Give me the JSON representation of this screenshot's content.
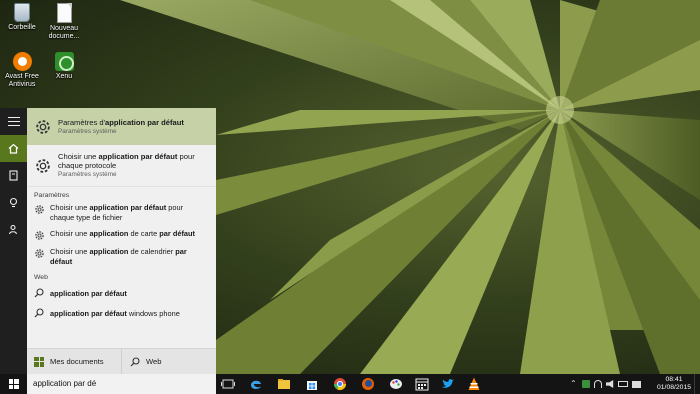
{
  "desktop": {
    "icons": [
      {
        "label": "Corbeille",
        "icon": "recycle-bin-icon"
      },
      {
        "label": "Nouveau docume...",
        "icon": "document-icon"
      },
      {
        "label": "Avast Free Antivirus",
        "icon": "avast-icon"
      },
      {
        "label": "Xenu",
        "icon": "xenu-icon"
      }
    ]
  },
  "start_rail": {
    "items": [
      "menu-icon",
      "home-icon",
      "notebook-icon",
      "lightbulb-icon",
      "feedback-icon"
    ]
  },
  "results": {
    "best_match": {
      "title_pre": "Paramètres d'",
      "title_bold": "application par défaut",
      "subtitle": "Paramètres système"
    },
    "second": {
      "line1_pre": "Choisir une ",
      "line1_bold": "application par défaut",
      "line1_post": " pour",
      "line2": "chaque protocole",
      "subtitle": "Paramètres système"
    },
    "settings_header": "Paramètres",
    "settings_items": [
      {
        "pre": "Choisir une ",
        "bold": "application par défaut",
        "post": " pour",
        "line2": "chaque type de fichier"
      },
      {
        "pre": "Choisir une ",
        "bold": "application",
        "mid": " de carte ",
        "bold2": "par défaut"
      },
      {
        "pre": "Choisir une ",
        "bold": "application",
        "mid": " de calendrier ",
        "bold2": "par",
        "line2": "défaut"
      }
    ],
    "web_header": "Web",
    "web_items": [
      {
        "bold": "application par défaut",
        "post": ""
      },
      {
        "bold": "application par défaut",
        "post": " windows phone"
      }
    ]
  },
  "scope": {
    "my_stuff": "Mes documents",
    "web": "Web"
  },
  "taskbar": {
    "search_value": "application par dé",
    "pinned": [
      "task-view-icon",
      "edge-icon",
      "file-explorer-icon",
      "store-icon",
      "chrome-icon",
      "firefox-icon",
      "paint-icon",
      "calendar-icon",
      "twitter-icon",
      "vlc-icon"
    ],
    "time": "08:41",
    "date": "01/08/2015"
  },
  "colors": {
    "accent": "#59781d",
    "best_match_bg": "#c6d1a8"
  }
}
